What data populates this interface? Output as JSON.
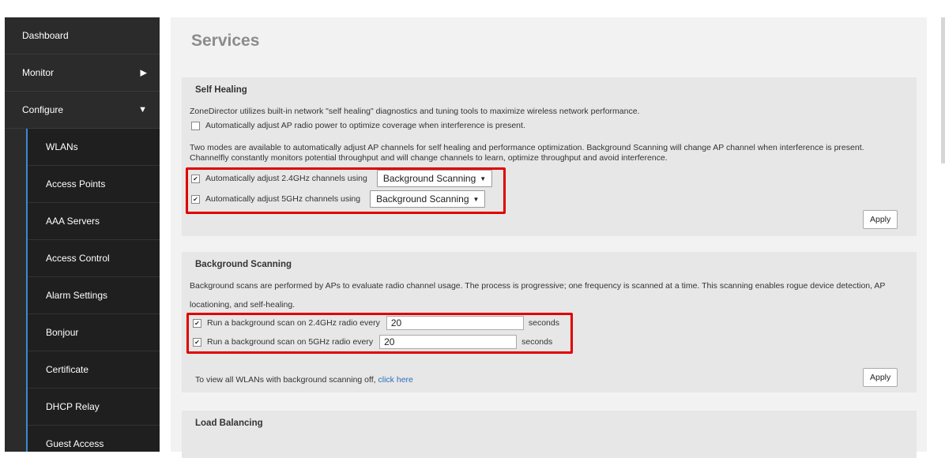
{
  "sidebar": {
    "top_items": [
      {
        "label": "Dashboard",
        "arrow": ""
      },
      {
        "label": "Monitor",
        "arrow": "▶"
      },
      {
        "label": "Configure",
        "arrow": "▼"
      }
    ],
    "sub_items": [
      {
        "label": "WLANs"
      },
      {
        "label": "Access Points"
      },
      {
        "label": "AAA Servers"
      },
      {
        "label": "Access Control"
      },
      {
        "label": "Alarm Settings"
      },
      {
        "label": "Bonjour"
      },
      {
        "label": "Certificate"
      },
      {
        "label": "DHCP Relay"
      },
      {
        "label": "Guest Access"
      }
    ]
  },
  "page": {
    "title": "Services"
  },
  "self_healing": {
    "title": "Self Healing",
    "intro": "ZoneDirector utilizes built-in network \"self healing\" diagnostics and tuning tools to maximize wireless network performance.",
    "auto_power_label": "Automatically adjust AP radio power to optimize coverage when interference is present.",
    "modes_line1": "Two modes are available to automatically adjust AP channels for self healing and performance optimization. Background Scanning will change AP channel when interference is present.",
    "modes_line2": "Channelfly constantly monitors potential throughput and will change channels to learn, optimize throughput and avoid interference.",
    "adjust_24_label": "Automatically adjust 2.4GHz channels using",
    "adjust_24_value": "Background Scanning",
    "adjust_5_label": "Automatically adjust 5GHz channels using",
    "adjust_5_value": "Background Scanning",
    "apply_label": "Apply"
  },
  "background_scanning": {
    "title": "Background Scanning",
    "desc_line1": "Background scans are performed by APs to evaluate radio channel usage. The process is progressive; one frequency is scanned at a time. This scanning enables rogue device detection, AP",
    "desc_line2": "locationing, and self-healing.",
    "scan_24_label": "Run a background scan on 2.4GHz radio every",
    "scan_24_value": "20",
    "scan_5_label": "Run a background scan on 5GHz radio every",
    "scan_5_value": "20",
    "units": "seconds",
    "apply_label": "Apply",
    "view_text": "To view all WLANs with background scanning off, ",
    "view_link": "click here"
  },
  "load_balancing": {
    "title": "Load Balancing"
  },
  "checks": {
    "checked": "✔"
  }
}
